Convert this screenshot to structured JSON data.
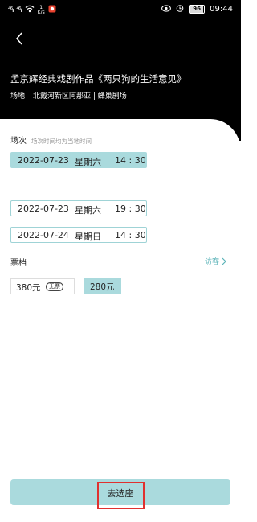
{
  "status_bar": {
    "signal_left": "⁴⁶ᵢₗ",
    "signal_right": "⁴⁶ᵢₗ",
    "net_speed_value": "1",
    "net_speed_unit": "K/s",
    "battery_level": "96",
    "time": "09:44",
    "icons": [
      "signal-icon",
      "wifi-icon",
      "notification-icon",
      "eye-icon",
      "alarm-icon",
      "battery-icon"
    ]
  },
  "header": {
    "back_icon": "chevron-left-icon",
    "title": "孟京辉经典戏剧作品《两只狗的生活意见》",
    "venue_label": "场地",
    "venue_value": "北戴河新区阿那亚 | 蜂巢剧场"
  },
  "sessions": {
    "title": "场次",
    "hint": "场次时间均为当地时间",
    "items": [
      {
        "date": "2022-07-23",
        "weekday": "星期六",
        "time": "14 : 30",
        "selected": true
      },
      {
        "date": "2022-07-23",
        "weekday": "星期六",
        "time": "19 : 30",
        "selected": false
      },
      {
        "date": "2022-07-24",
        "weekday": "星期日",
        "time": "14 : 30",
        "selected": false
      }
    ]
  },
  "tickets": {
    "title": "票档",
    "customer_link": "访客",
    "prices": [
      {
        "amount": "380元",
        "tag": "无票",
        "available": false
      },
      {
        "amount": "280元",
        "available": true,
        "selected": true
      }
    ]
  },
  "action": {
    "button_label": "去选座"
  },
  "colors": {
    "accent": "#aadadd",
    "accent_text": "#5bb3b8",
    "header_bg": "#000000",
    "highlight": "#e0302e"
  }
}
